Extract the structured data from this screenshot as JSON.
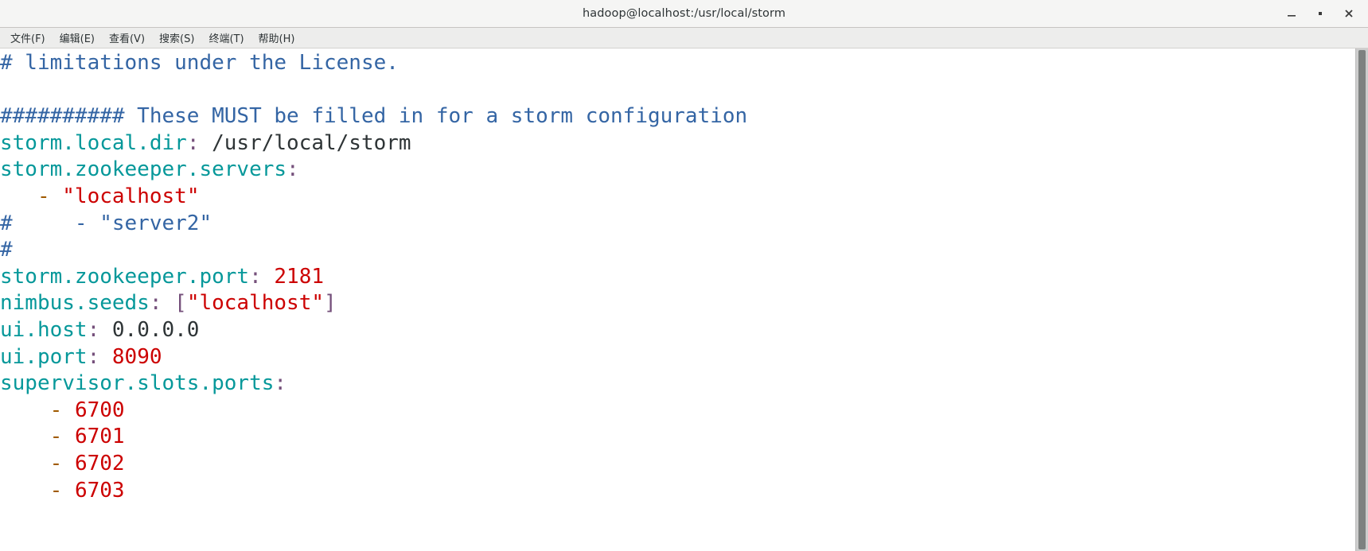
{
  "window": {
    "title": "hadoop@localhost:/usr/local/storm",
    "controls": [
      {
        "name": "minimize",
        "label": "–"
      },
      {
        "name": "maximize",
        "label": "■"
      },
      {
        "name": "close",
        "label": "✕"
      }
    ]
  },
  "menubar": {
    "items": [
      {
        "name": "file",
        "label": "文件(F)"
      },
      {
        "name": "edit",
        "label": "编辑(E)"
      },
      {
        "name": "view",
        "label": "查看(V)"
      },
      {
        "name": "search",
        "label": "搜索(S)"
      },
      {
        "name": "terminal",
        "label": "终端(T)"
      },
      {
        "name": "help",
        "label": "帮助(H)"
      }
    ]
  },
  "colors": {
    "comment": "#3465a4",
    "key": "#06989a",
    "punct": "#75507b",
    "string": "#cc0000",
    "number": "#cc0000",
    "plain": "#2e3436",
    "dash": "#a05a00",
    "titlebar_bg": "#f5f5f4",
    "menubar_bg": "#ededec",
    "terminal_bg": "#ffffff",
    "scrollbar_thumb": "#7e8180"
  },
  "terminal": {
    "lines": [
      {
        "id": "line-comment-limitations",
        "spans": [
          {
            "cls": "c-comment",
            "text": "# limitations under the License."
          }
        ]
      },
      {
        "id": "line-blank-1",
        "spans": [
          {
            "cls": "c-plain",
            "text": ""
          }
        ]
      },
      {
        "id": "line-comment-these-must",
        "spans": [
          {
            "cls": "c-comment",
            "text": "########## These MUST be filled in for a storm configuration"
          }
        ]
      },
      {
        "id": "line-storm-local-dir",
        "spans": [
          {
            "cls": "c-key",
            "text": "storm.local.dir"
          },
          {
            "cls": "c-punct",
            "text": ":"
          },
          {
            "cls": "c-plain",
            "text": " /usr/local/storm"
          }
        ]
      },
      {
        "id": "line-storm-zookeeper-servers",
        "spans": [
          {
            "cls": "c-key",
            "text": "storm.zookeeper.servers"
          },
          {
            "cls": "c-punct",
            "text": ":"
          }
        ]
      },
      {
        "id": "line-server-localhost",
        "spans": [
          {
            "cls": "c-plain",
            "text": "   "
          },
          {
            "cls": "c-dash",
            "text": "-"
          },
          {
            "cls": "c-plain",
            "text": " "
          },
          {
            "cls": "c-string",
            "text": "\"localhost\""
          }
        ]
      },
      {
        "id": "line-comment-server2",
        "spans": [
          {
            "cls": "c-comment",
            "text": "#     - \"server2\""
          }
        ]
      },
      {
        "id": "line-comment-hash",
        "spans": [
          {
            "cls": "c-comment",
            "text": "#"
          }
        ]
      },
      {
        "id": "line-storm-zookeeper-port",
        "spans": [
          {
            "cls": "c-key",
            "text": "storm.zookeeper.port"
          },
          {
            "cls": "c-punct",
            "text": ":"
          },
          {
            "cls": "c-plain",
            "text": " "
          },
          {
            "cls": "c-number",
            "text": "2181"
          }
        ]
      },
      {
        "id": "line-nimbus-seeds",
        "spans": [
          {
            "cls": "c-key",
            "text": "nimbus.seeds"
          },
          {
            "cls": "c-punct",
            "text": ":"
          },
          {
            "cls": "c-plain",
            "text": " "
          },
          {
            "cls": "c-punct",
            "text": "["
          },
          {
            "cls": "c-string",
            "text": "\"localhost\""
          },
          {
            "cls": "c-punct",
            "text": "]"
          }
        ]
      },
      {
        "id": "line-ui-host",
        "spans": [
          {
            "cls": "c-key",
            "text": "ui.host"
          },
          {
            "cls": "c-punct",
            "text": ":"
          },
          {
            "cls": "c-plain",
            "text": " 0.0.0.0"
          }
        ]
      },
      {
        "id": "line-ui-port",
        "spans": [
          {
            "cls": "c-key",
            "text": "ui.port"
          },
          {
            "cls": "c-punct",
            "text": ":"
          },
          {
            "cls": "c-plain",
            "text": " "
          },
          {
            "cls": "c-number",
            "text": "8090"
          }
        ]
      },
      {
        "id": "line-supervisor-slots-ports",
        "spans": [
          {
            "cls": "c-key",
            "text": "supervisor.slots.ports"
          },
          {
            "cls": "c-punct",
            "text": ":"
          }
        ]
      },
      {
        "id": "line-port-6700",
        "spans": [
          {
            "cls": "c-plain",
            "text": "    "
          },
          {
            "cls": "c-dash",
            "text": "-"
          },
          {
            "cls": "c-plain",
            "text": " "
          },
          {
            "cls": "c-number",
            "text": "6700"
          }
        ]
      },
      {
        "id": "line-port-6701",
        "spans": [
          {
            "cls": "c-plain",
            "text": "    "
          },
          {
            "cls": "c-dash",
            "text": "-"
          },
          {
            "cls": "c-plain",
            "text": " "
          },
          {
            "cls": "c-number",
            "text": "6701"
          }
        ]
      },
      {
        "id": "line-port-6702",
        "spans": [
          {
            "cls": "c-plain",
            "text": "    "
          },
          {
            "cls": "c-dash",
            "text": "-"
          },
          {
            "cls": "c-plain",
            "text": " "
          },
          {
            "cls": "c-number",
            "text": "6702"
          }
        ]
      },
      {
        "id": "line-port-6703",
        "spans": [
          {
            "cls": "c-plain",
            "text": "    "
          },
          {
            "cls": "c-dash",
            "text": "-"
          },
          {
            "cls": "c-plain",
            "text": " "
          },
          {
            "cls": "c-number",
            "text": "6703"
          }
        ]
      }
    ]
  }
}
